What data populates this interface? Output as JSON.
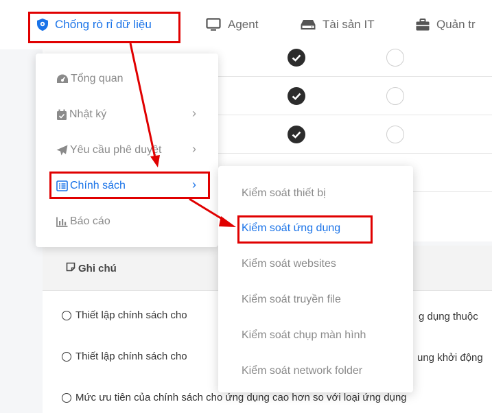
{
  "nav": {
    "items": [
      {
        "label": "Chống rò rỉ dữ liệu",
        "icon": "shield-icon",
        "active": true
      },
      {
        "label": "Agent",
        "icon": "monitor-icon",
        "active": false
      },
      {
        "label": "Tài sản IT",
        "icon": "hard-drive-icon",
        "active": false
      },
      {
        "label": "Quản tr",
        "icon": "briefcase-icon",
        "active": false
      }
    ]
  },
  "menu": {
    "items": [
      {
        "label": "Tổng quan",
        "icon": "dashboard-icon"
      },
      {
        "label": "Nhật ký",
        "icon": "calendar-icon",
        "chevron": "›"
      },
      {
        "label": "Yêu cầu phê duyệt",
        "icon": "paper-plane-icon",
        "chevron": "›"
      },
      {
        "label": "Chính sách",
        "icon": "list-icon",
        "chevron": "›",
        "active": true
      },
      {
        "label": "Báo cáo",
        "icon": "bar-chart-icon"
      }
    ]
  },
  "submenu": {
    "items": [
      {
        "label": "Kiểm soát thiết bị"
      },
      {
        "label": "Kiểm soát ứng dụng",
        "active": true
      },
      {
        "label": "Kiểm soát websites"
      },
      {
        "label": "Kiểm soát truyền file"
      },
      {
        "label": "Kiểm soát chụp màn hình"
      },
      {
        "label": "Kiểm soát network folder"
      }
    ]
  },
  "notes": {
    "title": "Ghi chú",
    "lines": [
      {
        "left": "Thiết lập chính sách cho",
        "right": "g dụng thuộc"
      },
      {
        "left": "Thiết lập chính sách cho",
        "right": "ung khởi động"
      },
      {
        "left": "Mức ưu tiên của chính sách cho ứng dụng cao hơn so với loại ứng dụng",
        "right": ""
      }
    ]
  },
  "colors": {
    "accent": "#1a73e8",
    "highlight": "#e00000"
  }
}
